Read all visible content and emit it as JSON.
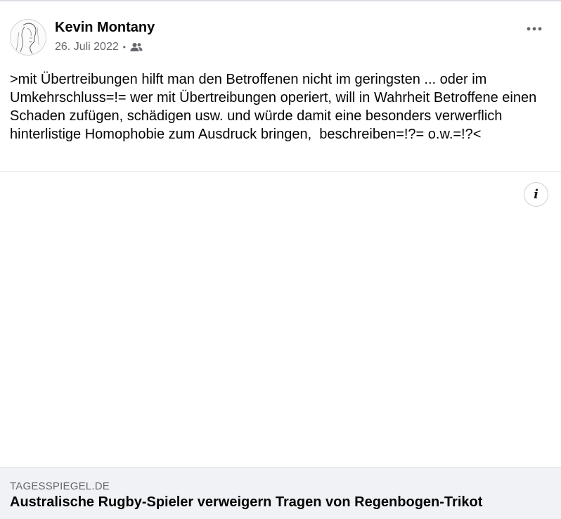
{
  "post": {
    "author": "Kevin Montany",
    "date": "26. Juli 2022",
    "separator": "•",
    "audience_icon": "friends-icon",
    "more_icon": "more-horizontal-icon",
    "text": ">mit Übertreibungen hilft man den Betroffenen nicht im geringsten ... oder im Umkehrschluss=!= wer mit Übertreibungen operiert, will in Wahrheit Betroffene einen Schaden zufügen, schädigen usw. und würde damit eine besonders verwerflich hinterlistige Homophobie zum Ausdruck bringen,  beschreiben=!?= o.w.=!?<"
  },
  "media": {
    "info_icon": "info-icon",
    "info_label": "i"
  },
  "link_preview": {
    "domain": "TAGESSPIEGEL.DE",
    "title": "Australische Rugby-Spieler verweigern Tragen von Regenbogen-Trikot",
    "background": "#f0f2f5"
  },
  "colors": {
    "text_primary": "#050505",
    "text_secondary": "#65676b",
    "divider": "#e4e6eb"
  }
}
